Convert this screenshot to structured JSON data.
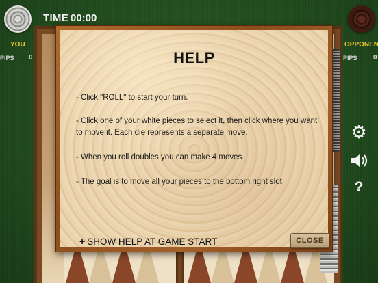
{
  "header": {
    "time_label": "TIME",
    "time_value": "00:00"
  },
  "player": {
    "label": "YOU",
    "pips_label": "PIPS",
    "pips_value": "0"
  },
  "opponent": {
    "label": "OPPONENT",
    "pips_label": "PIPS",
    "pips_value": "0"
  },
  "tools": {
    "settings_icon": "gear-icon",
    "sound_icon": "speaker-icon",
    "help_glyph": "?"
  },
  "help": {
    "title": "HELP",
    "lines": [
      "- Click \"ROLL\" to start your turn.",
      "- Click one of your white pieces to select it, then click where you want to move it.  Each die represents a separate move.",
      "- When you roll doubles you can make 4 moves.",
      "- The goal is to move all your pieces to the bottom right slot."
    ],
    "show_at_start_label": "SHOW HELP AT GAME START",
    "show_at_start_glyph": "+",
    "close_label": "CLOSE"
  },
  "colors": {
    "felt": "#1f4a1c",
    "accent_yellow": "#e9c42a",
    "frame": "#8c4e1c"
  }
}
